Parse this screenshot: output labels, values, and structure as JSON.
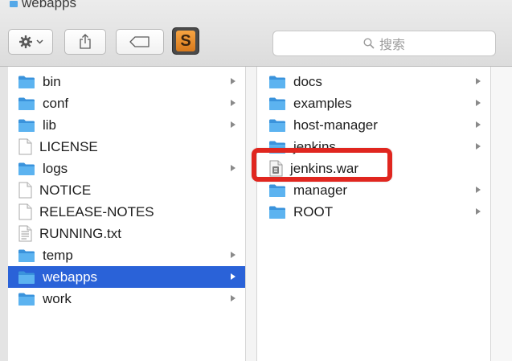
{
  "window": {
    "title": "webapps",
    "title_icon": "folder-icon"
  },
  "toolbar": {
    "action_icon": "gear-icon",
    "action_chevron": "chevron-down-icon",
    "share_icon": "share-icon",
    "tag_icon": "tag-icon",
    "app_icon": "sublime-text-icon",
    "app_letter": "S",
    "search_placeholder": "搜索",
    "search_icon": "search-icon"
  },
  "colors": {
    "selection": "#2a62d8",
    "folder": "#4aa3e8",
    "callout": "#e0261f"
  },
  "column1": {
    "items": [
      {
        "label": "bin",
        "kind": "folder",
        "has_children": true
      },
      {
        "label": "conf",
        "kind": "folder",
        "has_children": true
      },
      {
        "label": "lib",
        "kind": "folder",
        "has_children": true
      },
      {
        "label": "LICENSE",
        "kind": "file",
        "has_children": false
      },
      {
        "label": "logs",
        "kind": "folder",
        "has_children": true
      },
      {
        "label": "NOTICE",
        "kind": "file",
        "has_children": false
      },
      {
        "label": "RELEASE-NOTES",
        "kind": "file",
        "has_children": false
      },
      {
        "label": "RUNNING.txt",
        "kind": "textfile",
        "has_children": false
      },
      {
        "label": "temp",
        "kind": "folder",
        "has_children": true
      },
      {
        "label": "webapps",
        "kind": "folder",
        "has_children": true,
        "selected": true
      },
      {
        "label": "work",
        "kind": "folder",
        "has_children": true
      }
    ]
  },
  "column2": {
    "items": [
      {
        "label": "docs",
        "kind": "folder",
        "has_children": true
      },
      {
        "label": "examples",
        "kind": "folder",
        "has_children": true
      },
      {
        "label": "host-manager",
        "kind": "folder",
        "has_children": true
      },
      {
        "label": "jenkins",
        "kind": "folder",
        "has_children": true
      },
      {
        "label": "jenkins.war",
        "kind": "archive",
        "has_children": false,
        "highlighted": true
      },
      {
        "label": "manager",
        "kind": "folder",
        "has_children": true
      },
      {
        "label": "ROOT",
        "kind": "folder",
        "has_children": true
      }
    ]
  }
}
